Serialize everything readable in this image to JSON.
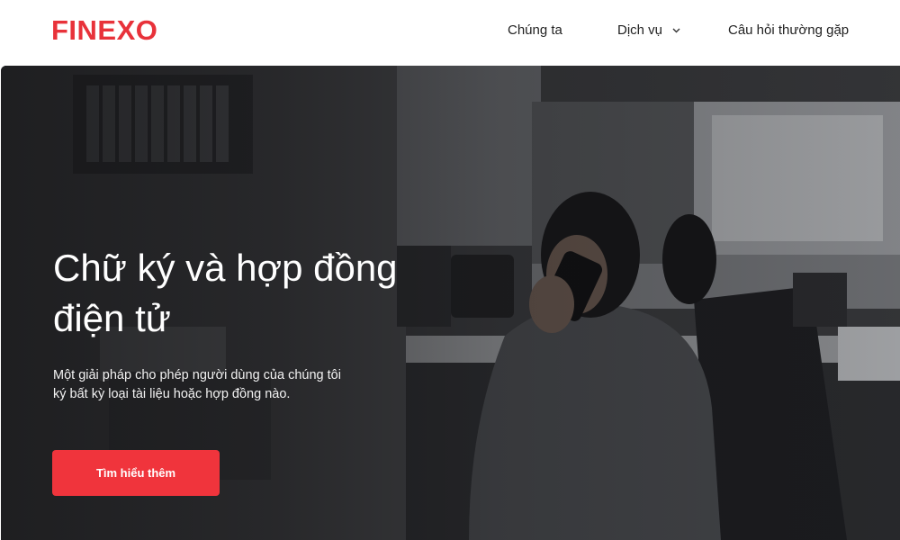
{
  "brand": {
    "name": "FINEXO",
    "accent_color": "#e8323a"
  },
  "nav": {
    "items": [
      {
        "label": "Chúng ta"
      },
      {
        "label": "Dịch vụ",
        "icon": "chevron-down-icon"
      },
      {
        "label": "Câu hỏi thường gặp"
      }
    ]
  },
  "hero": {
    "title": "Chữ ký và hợp đồng điện tử",
    "subtitle": "Một giải pháp cho phép người dùng của chúng tôi ký bất kỳ loại tài liệu hoặc hợp đồng nào.",
    "cta_label": "Tìm hiểu thêm",
    "cta_color": "#f0343c",
    "background_image": "office-woman-on-phone-photo"
  }
}
